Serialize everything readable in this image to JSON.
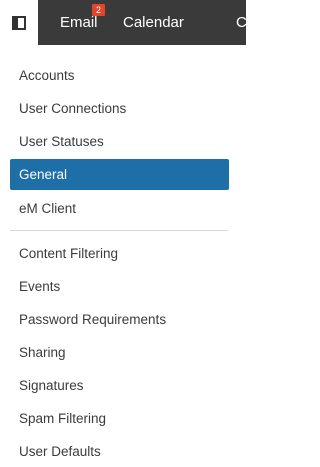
{
  "header": {
    "tabs": [
      {
        "label": "Email",
        "badge": "2"
      },
      {
        "label": "Calendar"
      },
      {
        "label": "Conta"
      }
    ]
  },
  "nav": {
    "group1": [
      "Accounts",
      "User Connections",
      "User Statuses",
      "General",
      "eM Client"
    ],
    "group2": [
      "Content Filtering",
      "Events",
      "Password Requirements",
      "Sharing",
      "Signatures",
      "Spam Filtering",
      "User Defaults"
    ],
    "active": "General"
  },
  "colors": {
    "topbar": "#3a3a3a",
    "active_item": "#1e6ea8",
    "badge": "#e2452c"
  }
}
